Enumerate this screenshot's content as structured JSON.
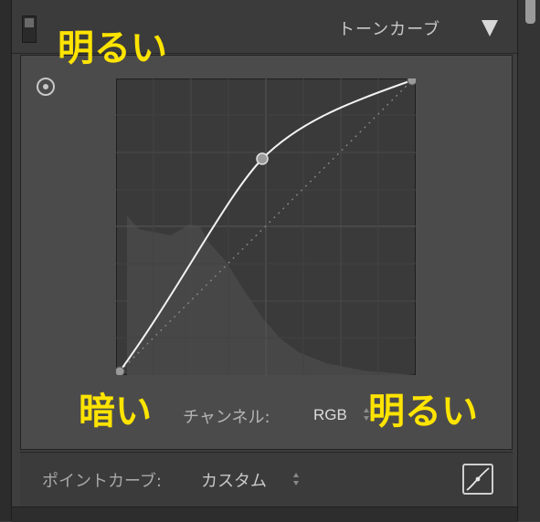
{
  "panel": {
    "title": "トーンカーブ"
  },
  "curve": {
    "points": [
      [
        0,
        0
      ],
      [
        0.5,
        0.72
      ],
      [
        1,
        1
      ]
    ]
  },
  "annotations": {
    "top_left": "明るい",
    "bottom_left": "暗い",
    "bottom_right": "明るい",
    "color": "#ffe400"
  },
  "channel": {
    "label": "チャンネル:",
    "value": "RGB"
  },
  "point_curve": {
    "label": "ポイントカーブ:",
    "value": "カスタム"
  }
}
